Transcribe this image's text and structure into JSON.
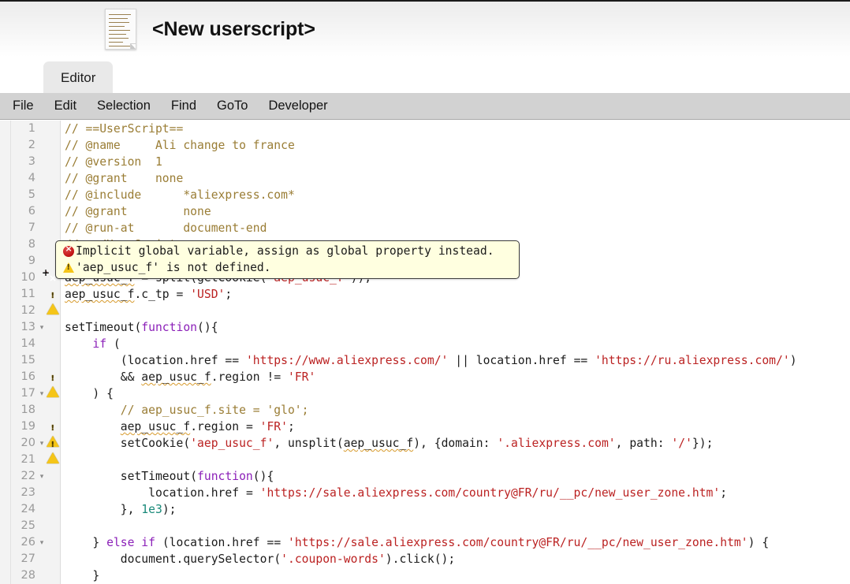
{
  "window": {
    "title": "<New userscript>",
    "thumbnail_icon": "script-document-thumbnail"
  },
  "tabs": [
    {
      "label": "Editor",
      "active": true
    }
  ],
  "menubar": {
    "items": [
      {
        "label": "File"
      },
      {
        "label": "Edit"
      },
      {
        "label": "Selection"
      },
      {
        "label": "Find"
      },
      {
        "label": "GoTo"
      },
      {
        "label": "Developer"
      }
    ]
  },
  "tooltip": {
    "visible": true,
    "lines": [
      {
        "icon": "error-icon",
        "text": "Implicit global variable, assign as global property instead."
      },
      {
        "icon": "warning-icon",
        "text": "'aep_usuc_f' is not defined."
      }
    ]
  },
  "colors": {
    "comment": "#9a7d35",
    "string": "#bb2222",
    "keyword": "#8b1fb8",
    "number": "#1a8a7a",
    "plain": "#1b1b1b",
    "gutter_bg": "#f3f3f3",
    "menubar_bg": "#d2d2d2",
    "tab_bg": "#e9e9e9",
    "tooltip_bg": "#ffffe0",
    "error": "#c01313",
    "warning": "#f5c518"
  },
  "editor": {
    "lines": [
      {
        "n": "1",
        "fold": "",
        "mark": "",
        "text": "// ==UserScript=="
      },
      {
        "n": "2",
        "fold": "",
        "mark": "",
        "text": "// @name     Ali change to france"
      },
      {
        "n": "3",
        "fold": "",
        "mark": "",
        "text": "// @version  1"
      },
      {
        "n": "4",
        "fold": "",
        "mark": "",
        "text": "// @grant    none"
      },
      {
        "n": "5",
        "fold": "",
        "mark": "",
        "text": "// @include      *aliexpress.com*"
      },
      {
        "n": "6",
        "fold": "",
        "mark": "",
        "text": "// @grant        none"
      },
      {
        "n": "7",
        "fold": "",
        "mark": "",
        "text": "// @run-at       document-end"
      },
      {
        "n": "8",
        "fold": "",
        "mark": "",
        "text": "// ==/UserScript=="
      },
      {
        "n": "9",
        "fold": "",
        "mark": "",
        "text": ""
      },
      {
        "n": "10",
        "fold": "",
        "mark": "error-plus",
        "text": "aep_usuc_f = split(getCookie('aep_usuc_f'));"
      },
      {
        "n": "11",
        "fold": "",
        "mark": "warning",
        "text": "aep_usuc_f.c_tp = 'USD';"
      },
      {
        "n": "12",
        "fold": "",
        "mark": "",
        "text": ""
      },
      {
        "n": "13",
        "fold": "▾",
        "mark": "",
        "text": "setTimeout(function(){"
      },
      {
        "n": "14",
        "fold": "",
        "mark": "",
        "text": "    if ("
      },
      {
        "n": "15",
        "fold": "",
        "mark": "",
        "text": "        (location.href == 'https://www.aliexpress.com/' || location.href == 'https://ru.aliexpress.com/')"
      },
      {
        "n": "16",
        "fold": "",
        "mark": "warning",
        "text": "        && aep_usuc_f.region != 'FR'"
      },
      {
        "n": "17",
        "fold": "▾",
        "mark": "",
        "text": "    ) {"
      },
      {
        "n": "18",
        "fold": "",
        "mark": "",
        "text": "        // aep_usuc_f.site = 'glo';"
      },
      {
        "n": "19",
        "fold": "",
        "mark": "warning",
        "text": "        aep_usuc_f.region = 'FR';"
      },
      {
        "n": "20",
        "fold": "▾",
        "mark": "warning",
        "text": "        setCookie('aep_usuc_f', unsplit(aep_usuc_f), {domain: '.aliexpress.com', path: '/'});"
      },
      {
        "n": "21",
        "fold": "",
        "mark": "",
        "text": ""
      },
      {
        "n": "22",
        "fold": "▾",
        "mark": "",
        "text": "        setTimeout(function(){"
      },
      {
        "n": "23",
        "fold": "",
        "mark": "",
        "text": "            location.href = 'https://sale.aliexpress.com/country@FR/ru/__pc/new_user_zone.htm';"
      },
      {
        "n": "24",
        "fold": "",
        "mark": "",
        "text": "        }, 1e3);"
      },
      {
        "n": "25",
        "fold": "",
        "mark": "",
        "text": ""
      },
      {
        "n": "26",
        "fold": "▾",
        "mark": "",
        "text": "    } else if (location.href == 'https://sale.aliexpress.com/country@FR/ru/__pc/new_user_zone.htm') {"
      },
      {
        "n": "27",
        "fold": "",
        "mark": "",
        "text": "        document.querySelector('.coupon-words').click();"
      },
      {
        "n": "28",
        "fold": "",
        "mark": "",
        "text": "    }"
      }
    ]
  }
}
